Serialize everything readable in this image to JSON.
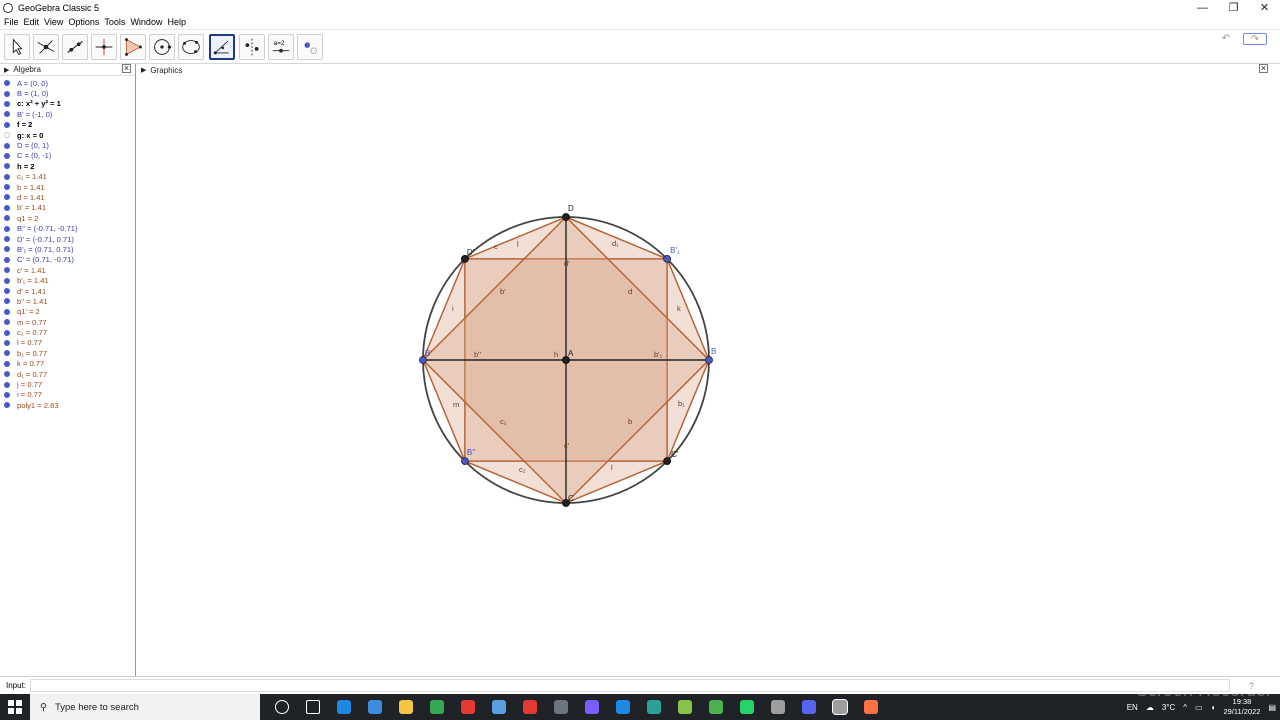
{
  "window": {
    "title": "GeoGebra Classic 5",
    "controls": [
      "—",
      "❐",
      "✕"
    ]
  },
  "menu": [
    "File",
    "Edit",
    "View",
    "Options",
    "Tools",
    "Window",
    "Help"
  ],
  "toolbar": {
    "tools": [
      "move-tool",
      "point-tool",
      "line-tool",
      "perpendicular-tool",
      "polygon-tool",
      "circle-tool",
      "circle-through-points-tool",
      "angle-tool",
      "reflect-tool",
      "slider-tool",
      "show-hide-tool"
    ],
    "selected": "angle-tool",
    "slider_label": "a=2",
    "undo": "↶",
    "redo": "↷"
  },
  "algebra": {
    "title": "Algebra",
    "items": [
      {
        "text": "A = (0, 0)",
        "color": "#3c3cb0",
        "bold": false
      },
      {
        "text": "B = (1, 0)",
        "color": "#3c3cb0",
        "bold": false
      },
      {
        "text": "c: x² + y² = 1",
        "color": "#000000",
        "bold": true
      },
      {
        "text": "B' = (-1, 0)",
        "color": "#3c3cb0",
        "bold": false
      },
      {
        "text": "f = 2",
        "color": "#000000",
        "bold": true
      },
      {
        "text": "g: x = 0",
        "color": "#000000",
        "bold": true
      },
      {
        "text": "D = (0, 1)",
        "color": "#3c3cb0",
        "bold": false
      },
      {
        "text": "C = (0, -1)",
        "color": "#3c3cb0",
        "bold": false
      },
      {
        "text": "h = 2",
        "color": "#000000",
        "bold": true
      },
      {
        "text": "c₁ = 1.41",
        "color": "#9a4a1a",
        "bold": false
      },
      {
        "text": "b = 1.41",
        "color": "#9a4a1a",
        "bold": false
      },
      {
        "text": "d = 1.41",
        "color": "#9a4a1a",
        "bold": false
      },
      {
        "text": "b' = 1.41",
        "color": "#9a4a1a",
        "bold": false
      },
      {
        "text": "q1 = 2",
        "color": "#9a4a1a",
        "bold": false
      },
      {
        "text": "B'' = (-0.71, -0.71)",
        "color": "#3c3cb0",
        "bold": false
      },
      {
        "text": "D' = (-0.71, 0.71)",
        "color": "#3c3cb0",
        "bold": false
      },
      {
        "text": "B'₁ = (0.71, 0.71)",
        "color": "#3c3cb0",
        "bold": false
      },
      {
        "text": "C' = (0.71, -0.71)",
        "color": "#3c3cb0",
        "bold": false
      },
      {
        "text": "c' = 1.41",
        "color": "#9a4a1a",
        "bold": false
      },
      {
        "text": "b'₁ = 1.41",
        "color": "#9a4a1a",
        "bold": false
      },
      {
        "text": "d' = 1.41",
        "color": "#9a4a1a",
        "bold": false
      },
      {
        "text": "b'' = 1.41",
        "color": "#9a4a1a",
        "bold": false
      },
      {
        "text": "q1' = 2",
        "color": "#9a4a1a",
        "bold": false
      },
      {
        "text": "m = 0.77",
        "color": "#9a4a1a",
        "bold": false
      },
      {
        "text": "c₂ = 0.77",
        "color": "#9a4a1a",
        "bold": false
      },
      {
        "text": "l = 0.77",
        "color": "#9a4a1a",
        "bold": false
      },
      {
        "text": "b₁ = 0.77",
        "color": "#9a4a1a",
        "bold": false
      },
      {
        "text": "k = 0.77",
        "color": "#9a4a1a",
        "bold": false
      },
      {
        "text": "d₁ = 0.77",
        "color": "#9a4a1a",
        "bold": false
      },
      {
        "text": "j = 0.77",
        "color": "#9a4a1a",
        "bold": false
      },
      {
        "text": "i = 0.77",
        "color": "#9a4a1a",
        "bold": false
      },
      {
        "text": "poly1 = 2.83",
        "color": "#9a4a1a",
        "bold": false
      }
    ]
  },
  "graphics": {
    "title": "Graphics",
    "points": {
      "A": "A",
      "B": "B",
      "B'": "B'",
      "C": "C",
      "D": "D",
      "B''": "B''",
      "D'": "D'",
      "B'1": "B'₁",
      "C'": "C'"
    },
    "segment_labels": {
      "c": "c",
      "j": "j",
      "d1": "d₁",
      "i": "i",
      "k": "k",
      "b'": "b'",
      "d": "d",
      "m": "m",
      "c1": "c₁",
      "b": "b",
      "b1": "b₁",
      "c2": "c₂",
      "l": "l",
      "h": "h",
      "b''": "b''",
      "b'1": "b'₁",
      "d'": "d'",
      "c'": "c'"
    },
    "colors": {
      "circle": "#444444",
      "octagon": "#b5653a",
      "fill": "#d9a58a",
      "axis": "#222222",
      "point": "#4a58c8"
    }
  },
  "input": {
    "label": "Input:",
    "help": "?"
  },
  "taskbar": {
    "search_placeholder": "Type here to search",
    "icons": [
      "task-view-icon",
      "cortana-icon",
      "edge-icon",
      "store-icon",
      "explorer-icon",
      "chrome-icon",
      "opera-icon",
      "paint-icon",
      "opera-gx-icon",
      "calculator-icon",
      "messenger-icon",
      "defender-icon",
      "ccleaner-icon",
      "green-app-icon",
      "game-icon",
      "whatsapp-icon",
      "clock-app-icon",
      "discord-icon",
      "geogebra-icon",
      "recorder-icon"
    ],
    "lang": "EN",
    "weather": "3°C",
    "time": "19:38",
    "date": "29/11/2022",
    "watermark": "Screen Recorder"
  }
}
